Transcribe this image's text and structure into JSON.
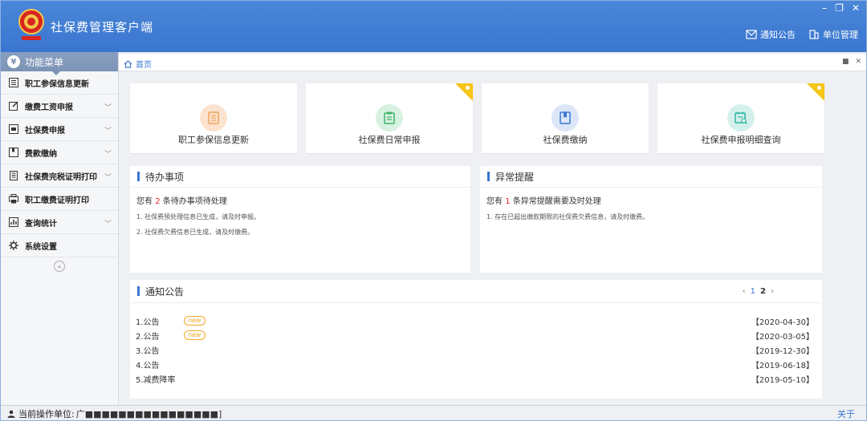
{
  "header": {
    "app_title": "社保费管理客户端",
    "links": [
      {
        "label": "通知公告",
        "icon": "mail-icon"
      },
      {
        "label": "单位管理",
        "icon": "building-icon"
      }
    ],
    "window_controls": [
      "–",
      "❐",
      "✕"
    ]
  },
  "sidebar": {
    "title": "功能菜单",
    "items": [
      {
        "label": "职工参保信息更新",
        "icon": "list-icon",
        "expandable": false
      },
      {
        "label": "缴费工资申报",
        "icon": "edit-icon",
        "expandable": true
      },
      {
        "label": "社保费申报",
        "icon": "form-icon",
        "expandable": true
      },
      {
        "label": "费款缴纳",
        "icon": "book-icon",
        "expandable": true
      },
      {
        "label": "社保费完税证明打印",
        "icon": "receipt-icon",
        "expandable": true
      },
      {
        "label": "职工缴费证明打印",
        "icon": "print-icon",
        "expandable": false
      },
      {
        "label": "查询统计",
        "icon": "chart-icon",
        "expandable": true
      },
      {
        "label": "系统设置",
        "icon": "gear-icon",
        "expandable": false
      }
    ],
    "chevron": "﹀",
    "collapse": "«"
  },
  "tabbar": {
    "home_label": "首页",
    "controls": [
      "■",
      "✕"
    ]
  },
  "cards": [
    {
      "label": "职工参保信息更新",
      "color": "#fbe3cf",
      "icon_color": "#f0a35a",
      "flag": false
    },
    {
      "label": "社保费日常申报",
      "color": "#d8f1e0",
      "icon_color": "#3fb56a",
      "flag": true
    },
    {
      "label": "社保费缴纳",
      "color": "#dce6f8",
      "icon_color": "#3a76cf",
      "flag": false
    },
    {
      "label": "社保费申报明细查询",
      "color": "#d4f0ec",
      "icon_color": "#2bb5a0",
      "flag": true
    }
  ],
  "todo": {
    "title": "待办事项",
    "prefix": "您有",
    "count": "2",
    "suffix": "条待办事项待处理",
    "lines": [
      "1. 社保费预处理信息已生成，请及时申报。",
      "2. 社保费欠费信息已生成，请及时缴费。"
    ]
  },
  "alert": {
    "title": "异常提醒",
    "prefix": "您有",
    "count": "1",
    "suffix": "条异常提醒需要及时处理",
    "lines": [
      "1. 存在已超出缴款期限的社保费欠费信息，请及时缴费。"
    ]
  },
  "notices": {
    "title": "通知公告",
    "pager": {
      "prev": "‹",
      "page1": "1",
      "page2": "2",
      "next": "›"
    },
    "new_label": "new",
    "rows": [
      {
        "title": "1.公告",
        "is_new": true,
        "date": "【2020-04-30】"
      },
      {
        "title": "2.公告",
        "is_new": true,
        "date": "【2020-03-05】"
      },
      {
        "title": "3.公告",
        "is_new": false,
        "date": "【2019-12-30】"
      },
      {
        "title": "4.公告",
        "is_new": false,
        "date": "【2019-06-18】"
      },
      {
        "title": "5.减费降率",
        "is_new": false,
        "date": "【2019-05-10】"
      }
    ]
  },
  "statusbar": {
    "label": "当前操作单位:",
    "value": "广■■■■■■■■■■■■■■■■]",
    "right": "关于"
  }
}
